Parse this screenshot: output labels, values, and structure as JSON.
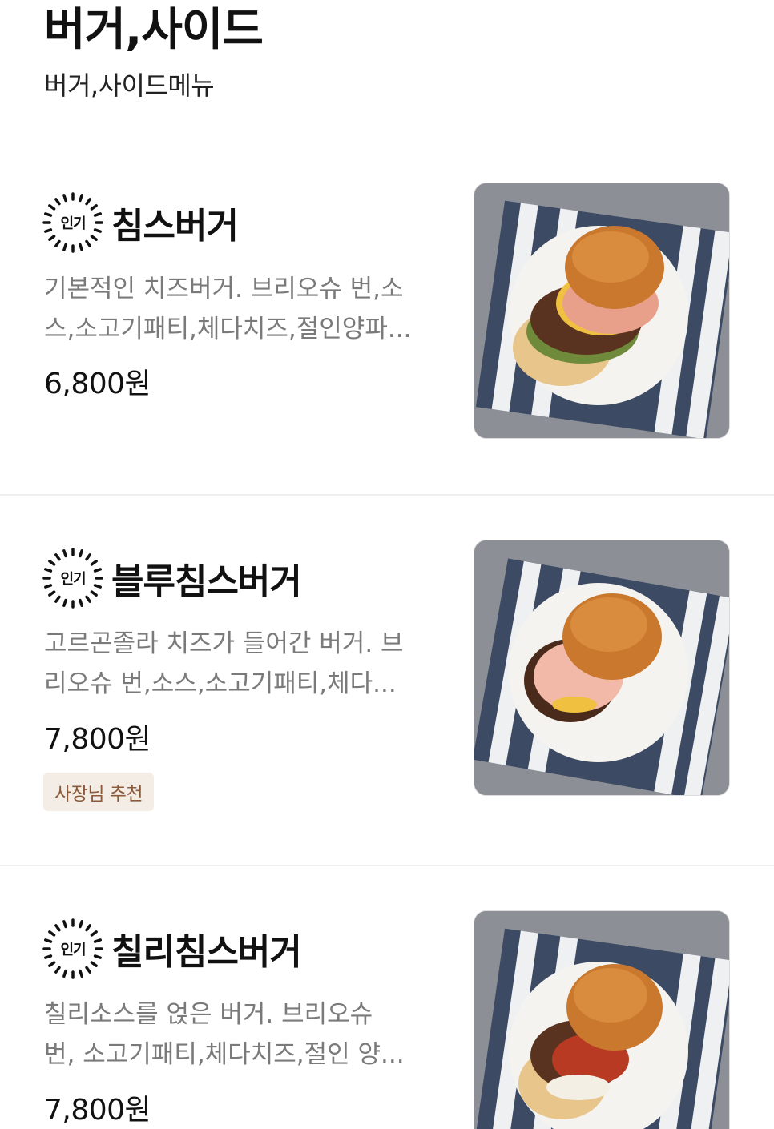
{
  "section": {
    "title": "버거,사이드",
    "subtitle": "버거,사이드메뉴"
  },
  "items": [
    {
      "badge": "인기",
      "name": "침스버거",
      "desc_line1": "기본적인 치즈버거. 브리오슈 번,소",
      "desc_line2": "스,소고기패티,체다치즈,절인양파...",
      "price": "6,800원",
      "photo_icon": "burger-photo"
    },
    {
      "badge": "인기",
      "name": "블루침스버거",
      "desc_line1": "고르곤졸라 치즈가 들어간 버거. 브",
      "desc_line2": "리오슈 번,소스,소고기패티,체다...",
      "price": "7,800원",
      "tag": "사장님 추천",
      "photo_icon": "burger-photo"
    },
    {
      "badge": "인기",
      "name": "칠리침스버거",
      "desc_line1": "칠리소스를 얹은 버거. 브리오슈",
      "desc_line2": "번, 소고기패티,체다치즈,절인 양...",
      "price": "7,800원",
      "photo_icon": "burger-photo"
    }
  ],
  "colors": {
    "photo_bg": "#8a8d93",
    "tag_bg": "#f4ede6",
    "tag_text": "#8a5a3a",
    "desc_text": "#7a7a7a"
  }
}
